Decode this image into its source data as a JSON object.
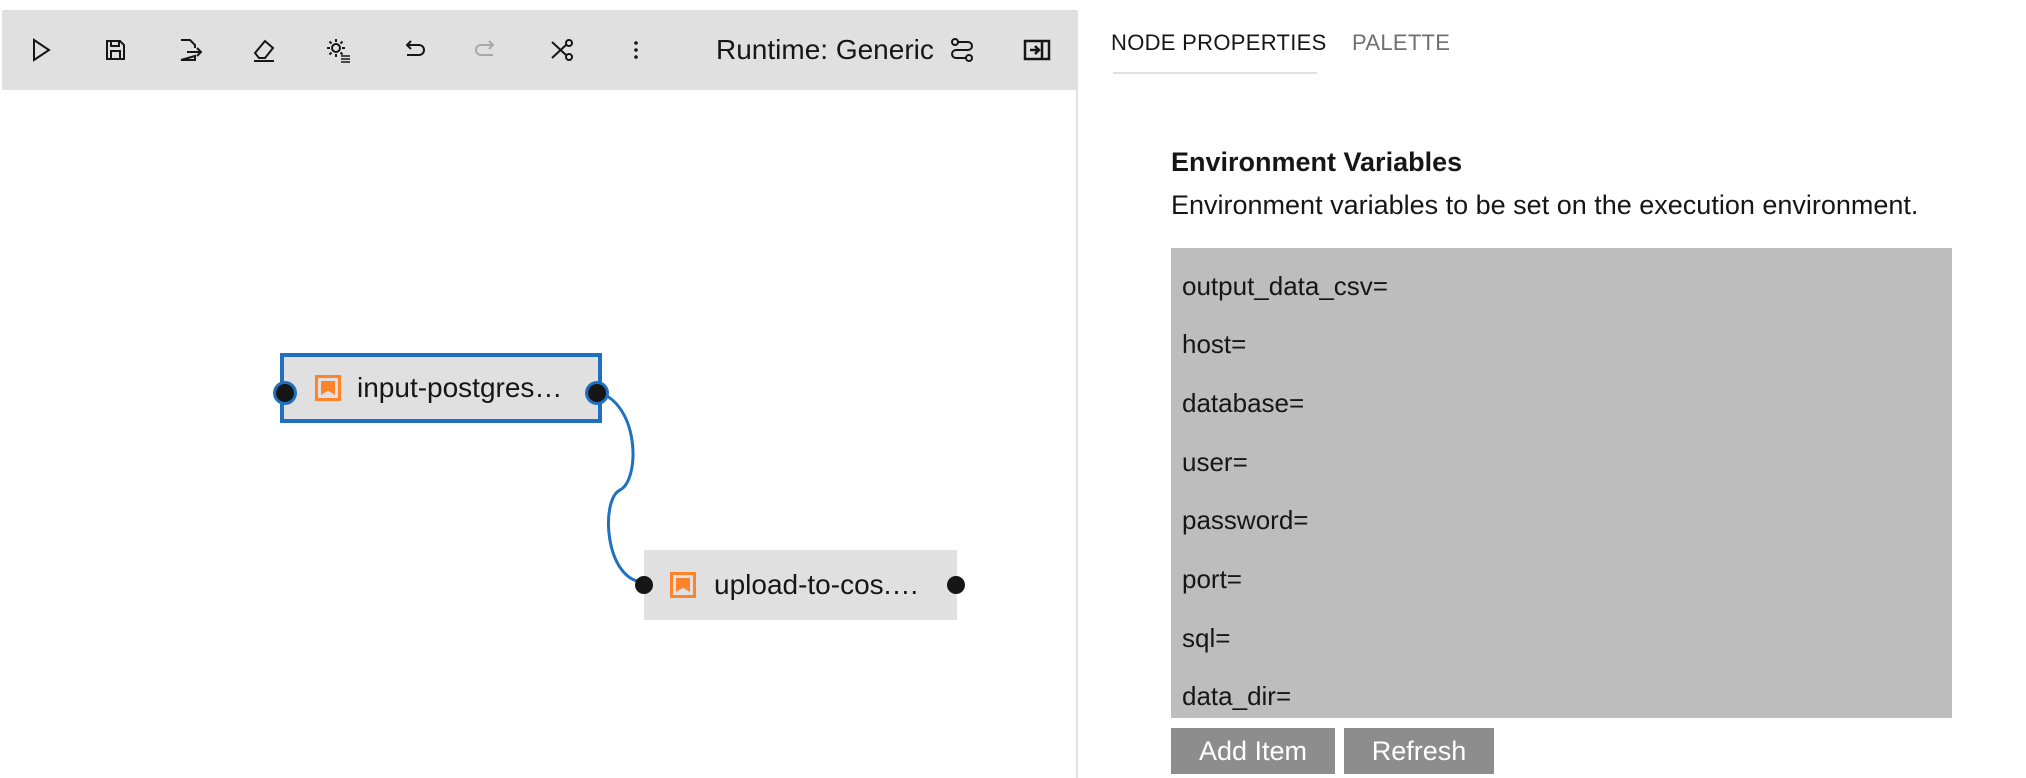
{
  "toolbar": {
    "icons": [
      "run-icon",
      "save-icon",
      "export-icon",
      "clear-icon",
      "settings-icon",
      "undo-icon",
      "redo-icon",
      "cut-icon",
      "more-icon",
      "pipeline-icon",
      "panel-toggle-icon"
    ],
    "runtime_label": "Runtime: Generic"
  },
  "nodes": [
    {
      "label": "input-postgres…",
      "selected": true
    },
    {
      "label": "upload-to-cos.…",
      "selected": false
    }
  ],
  "panel": {
    "tabs": [
      {
        "label": "NODE PROPERTIES",
        "active": true
      },
      {
        "label": "PALETTE",
        "active": false
      }
    ],
    "section_title": "Environment Variables",
    "section_description": "Environment variables to be set on the execution environment.",
    "env_vars": [
      "output_data_csv=",
      "host=",
      "database=",
      "user=",
      "password=",
      "port=",
      "sql=",
      "data_dir="
    ],
    "add_item_label": "Add Item",
    "refresh_label": "Refresh"
  },
  "colors": {
    "toolbar_bg": "#e0e0e0",
    "selection_blue": "#1f70c1",
    "node_icon_orange": "#ff832b",
    "env_box_bg": "#bdbdbd",
    "button_bg": "#8d8d8d"
  }
}
